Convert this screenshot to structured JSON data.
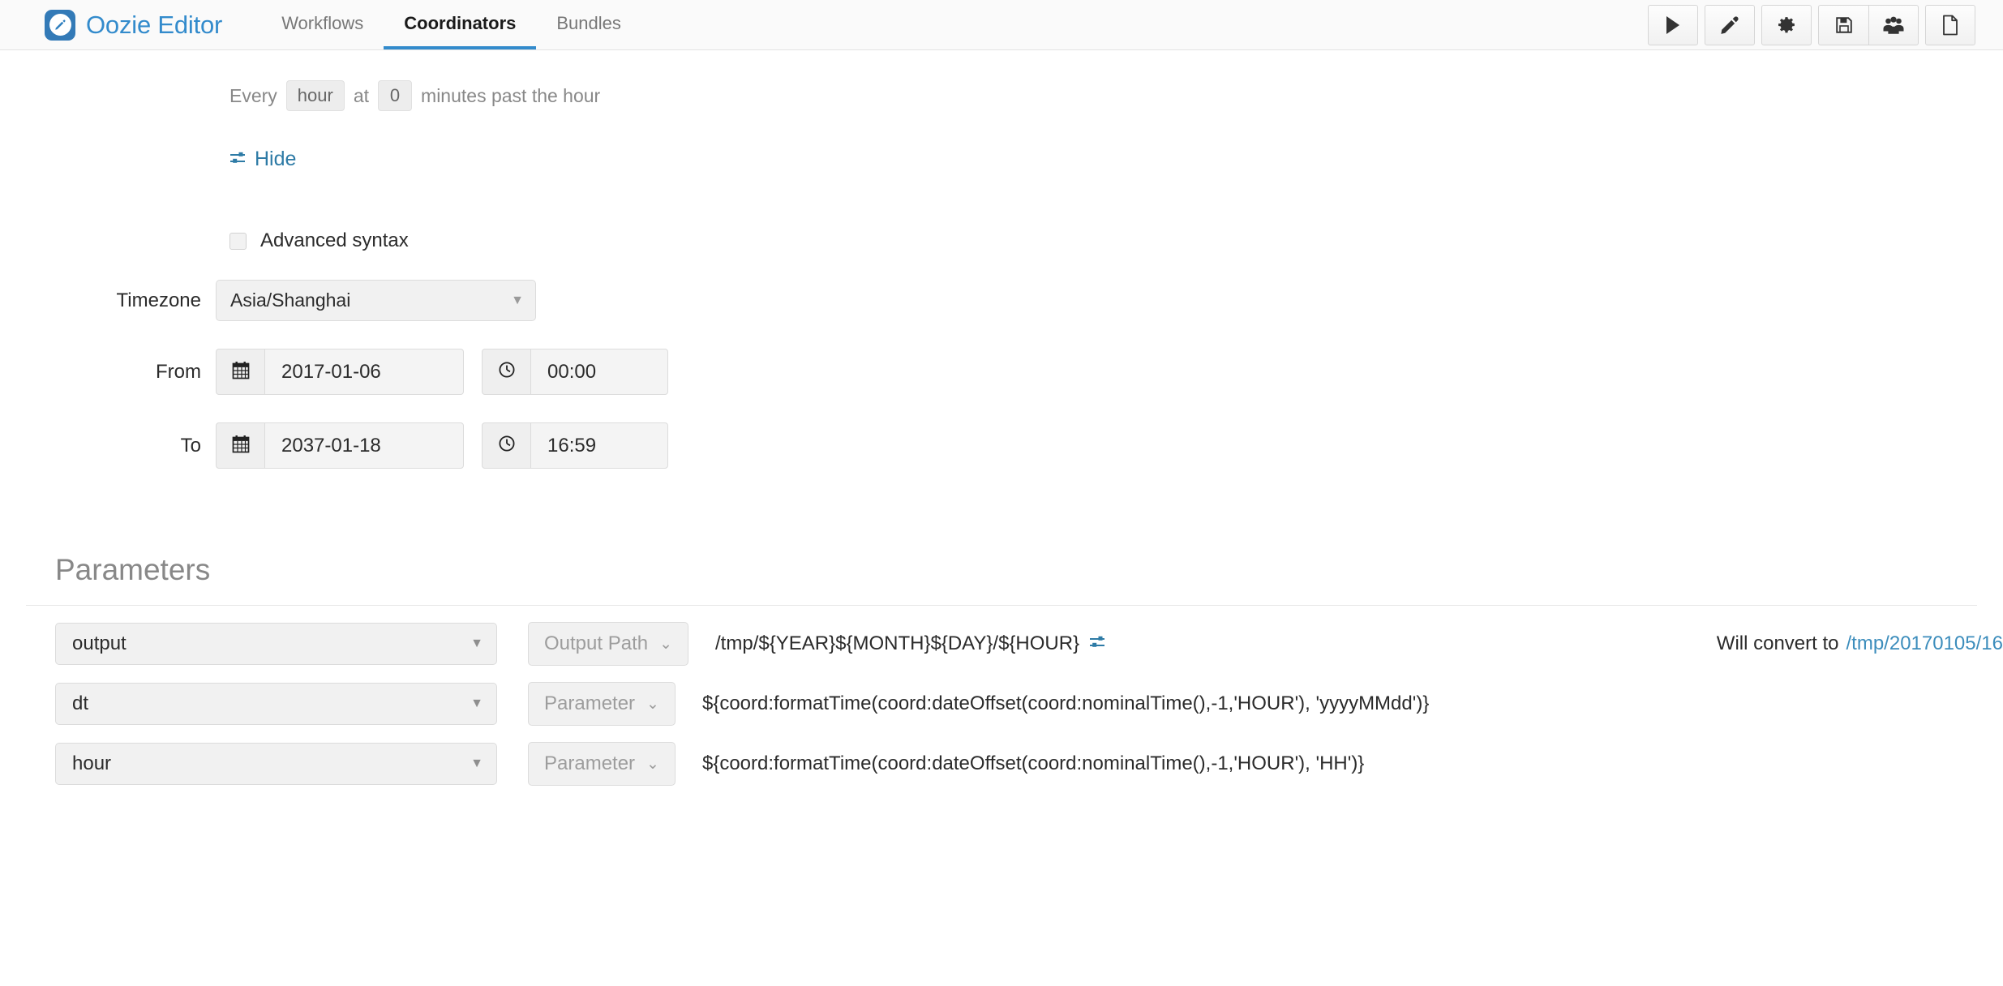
{
  "header": {
    "brand": "Oozie Editor",
    "logo_icon": "pencil-logo-icon",
    "tabs": [
      {
        "label": "Workflows",
        "active": false
      },
      {
        "label": "Coordinators",
        "active": true
      },
      {
        "label": "Bundles",
        "active": false
      }
    ],
    "toolbar": [
      {
        "name": "run-button",
        "icon": "play-icon"
      },
      {
        "name": "edit-button",
        "icon": "pencil-icon"
      },
      {
        "name": "settings-button",
        "icon": "gear-icon"
      },
      {
        "name": "save-button",
        "icon": "floppy-save-icon"
      },
      {
        "name": "share-button",
        "icon": "users-group-icon"
      },
      {
        "name": "new-button",
        "icon": "document-icon"
      }
    ],
    "accent_color": "#338bcc"
  },
  "schedule": {
    "frequency": {
      "prefix": "Every",
      "unit": "hour",
      "middle": "at",
      "minutes": "0",
      "suffix": "minutes past the hour"
    },
    "hide_link": {
      "label": "Hide",
      "icon": "sliders-icon"
    },
    "advanced_syntax": {
      "label": "Advanced syntax",
      "checked": false
    },
    "timezone": {
      "label": "Timezone",
      "value": "Asia/Shanghai"
    },
    "from": {
      "label": "From",
      "date": "2017-01-06",
      "time": "00:00",
      "date_icon": "calendar-icon",
      "time_icon": "clock-icon"
    },
    "to": {
      "label": "To",
      "date": "2037-01-18",
      "time": "16:59",
      "date_icon": "calendar-icon",
      "time_icon": "clock-icon"
    }
  },
  "parameters": {
    "title": "Parameters",
    "rows": [
      {
        "name": "output",
        "type": "Output Path",
        "value": "/tmp/${YEAR}${MONTH}${DAY}/${HOUR}",
        "has_sliders_icon": true,
        "convert_prefix": "Will convert to",
        "convert_value": "/tmp/20170105/16"
      },
      {
        "name": "dt",
        "type": "Parameter",
        "value": "${coord:formatTime(coord:dateOffset(coord:nominalTime(),-1,'HOUR'), 'yyyyMMdd')}",
        "has_sliders_icon": false,
        "convert_prefix": "",
        "convert_value": ""
      },
      {
        "name": "hour",
        "type": "Parameter",
        "value": "${coord:formatTime(coord:dateOffset(coord:nominalTime(),-1,'HOUR'), 'HH')}",
        "has_sliders_icon": false,
        "convert_prefix": "",
        "convert_value": ""
      }
    ]
  }
}
